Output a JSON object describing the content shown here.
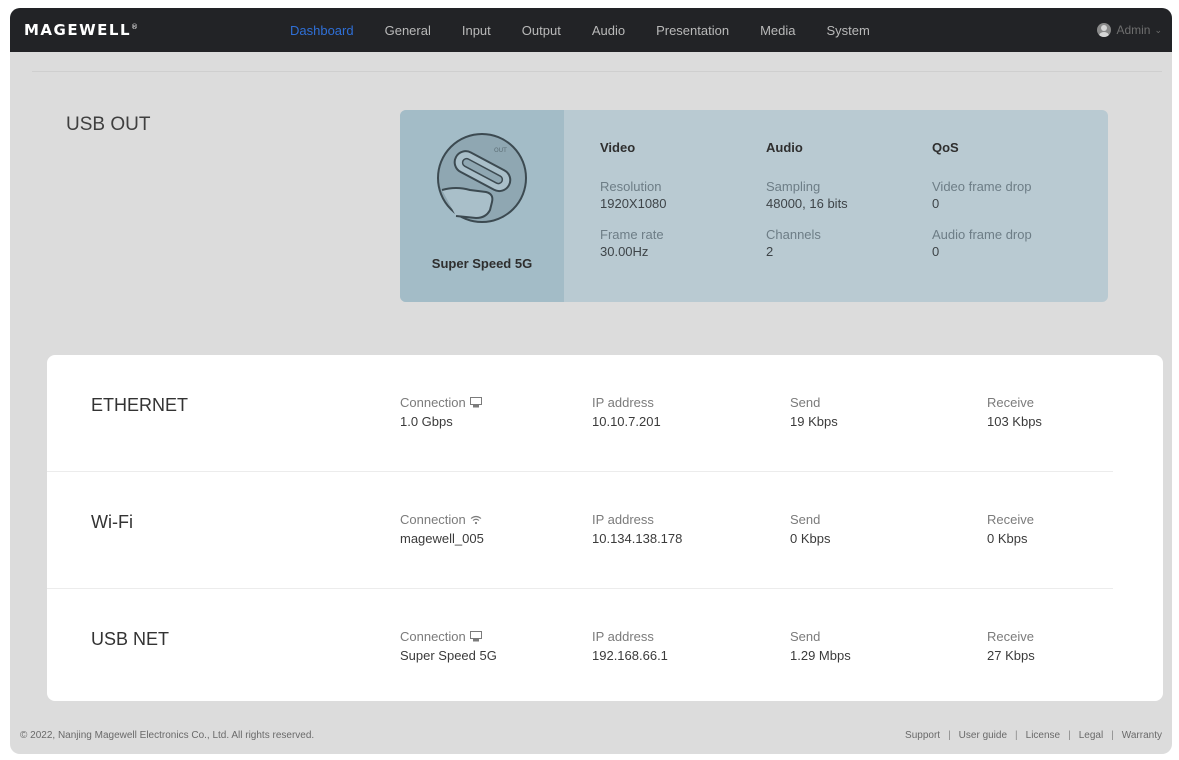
{
  "brand": {
    "logo": "MAGEWELL",
    "reg": "®"
  },
  "nav": {
    "items": [
      {
        "label": "Dashboard",
        "active": true
      },
      {
        "label": "General"
      },
      {
        "label": "Input"
      },
      {
        "label": "Output"
      },
      {
        "label": "Audio"
      },
      {
        "label": "Presentation"
      },
      {
        "label": "Media"
      },
      {
        "label": "System"
      }
    ],
    "user": "Admin"
  },
  "usb_out": {
    "title": "USB OUT",
    "speed": "Super Speed 5G",
    "video": {
      "heading": "Video",
      "resolution_label": "Resolution",
      "resolution": "1920X1080",
      "framerate_label": "Frame rate",
      "framerate": "30.00Hz"
    },
    "audio": {
      "heading": "Audio",
      "sampling_label": "Sampling",
      "sampling": "48000, 16 bits",
      "channels_label": "Channels",
      "channels": "2"
    },
    "qos": {
      "heading": "QoS",
      "video_drop_label": "Video frame drop",
      "video_drop": "0",
      "audio_drop_label": "Audio frame drop",
      "audio_drop": "0"
    }
  },
  "network": [
    {
      "title": "ETHERNET",
      "connection_label": "Connection",
      "connection_icon": "ethernet-icon",
      "connection": "1.0 Gbps",
      "ip_label": "IP address",
      "ip": "10.10.7.201",
      "send_label": "Send",
      "send": "19 Kbps",
      "receive_label": "Receive",
      "receive": "103 Kbps"
    },
    {
      "title": "Wi-Fi",
      "connection_label": "Connection",
      "connection_icon": "wifi-icon",
      "connection": "magewell_005",
      "ip_label": "IP address",
      "ip": "10.134.138.178",
      "send_label": "Send",
      "send": "0 Kbps",
      "receive_label": "Receive",
      "receive": "0 Kbps"
    },
    {
      "title": "USB NET",
      "connection_label": "Connection",
      "connection_icon": "ethernet-icon",
      "connection": "Super Speed 5G",
      "ip_label": "IP address",
      "ip": "192.168.66.1",
      "send_label": "Send",
      "send": "1.29 Mbps",
      "receive_label": "Receive",
      "receive": "27 Kbps"
    }
  ],
  "footer": {
    "copyright": "© 2022, Nanjing Magewell Electronics Co., Ltd. All rights reserved.",
    "links": [
      "Support",
      "User guide",
      "License",
      "Legal",
      "Warranty"
    ]
  },
  "colors": {
    "nav_bg": "#222326",
    "active": "#2f6fd6",
    "card": "#b9cad2"
  }
}
